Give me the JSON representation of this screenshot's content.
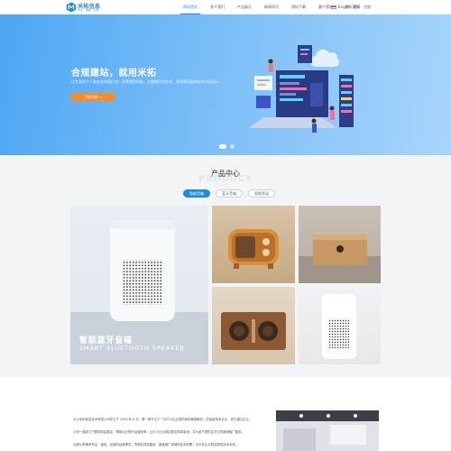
{
  "header": {
    "logo_text": "米拓信息",
    "logo_sub": "专业 · 诚信 · 创新",
    "nav": [
      "网站首页",
      "关于我们",
      "产品展示",
      "新闻资讯",
      "资料下载",
      "客户案例",
      "招人我们"
    ],
    "active_nav": 0,
    "language": "English",
    "login": "登录",
    "register": "注册"
  },
  "hero": {
    "title": "合规建站，就用米拓",
    "subtitle": "让专业的个人和企业快速打造一流营销型网站，无需懂任何技术，多终端适配响应式布局展示",
    "button": "了解详情 →",
    "slides": 2,
    "active_slide": 0
  },
  "products": {
    "title": "产品中心",
    "title_en": "PRODUCT",
    "tabs": [
      "智能音箱",
      "蓝牙音箱",
      "智能家居"
    ],
    "active_tab": 0,
    "featured_title": "智能蓝牙音箱",
    "featured_subtitle": "SMART BLUETOOTH SPEAKER"
  },
  "about": {
    "paragraphs": [
      "长沙米拓信息技术有限公司成立于 2009 年 6 月，是一家专注于「为中小企业提供网络营销服务」的高新技术企业，现已通过企业。",
      "公司一直致力于服务网站建设，帮助企业提升运营效率，让中小企业网站更加简单易用，并为用户提供全方位的营销推广服务。",
      "长期以来秉承专注、诚信、创新的经营理念，凭借在网站建设、营销推广领域的技术积累，为众多企业网站提供技术支持。"
    ]
  },
  "colors": {
    "brand": "#1c8bd9",
    "accent": "#ff8a1e",
    "hero_start": "#4da6f3",
    "hero_end": "#a8d5fb"
  }
}
